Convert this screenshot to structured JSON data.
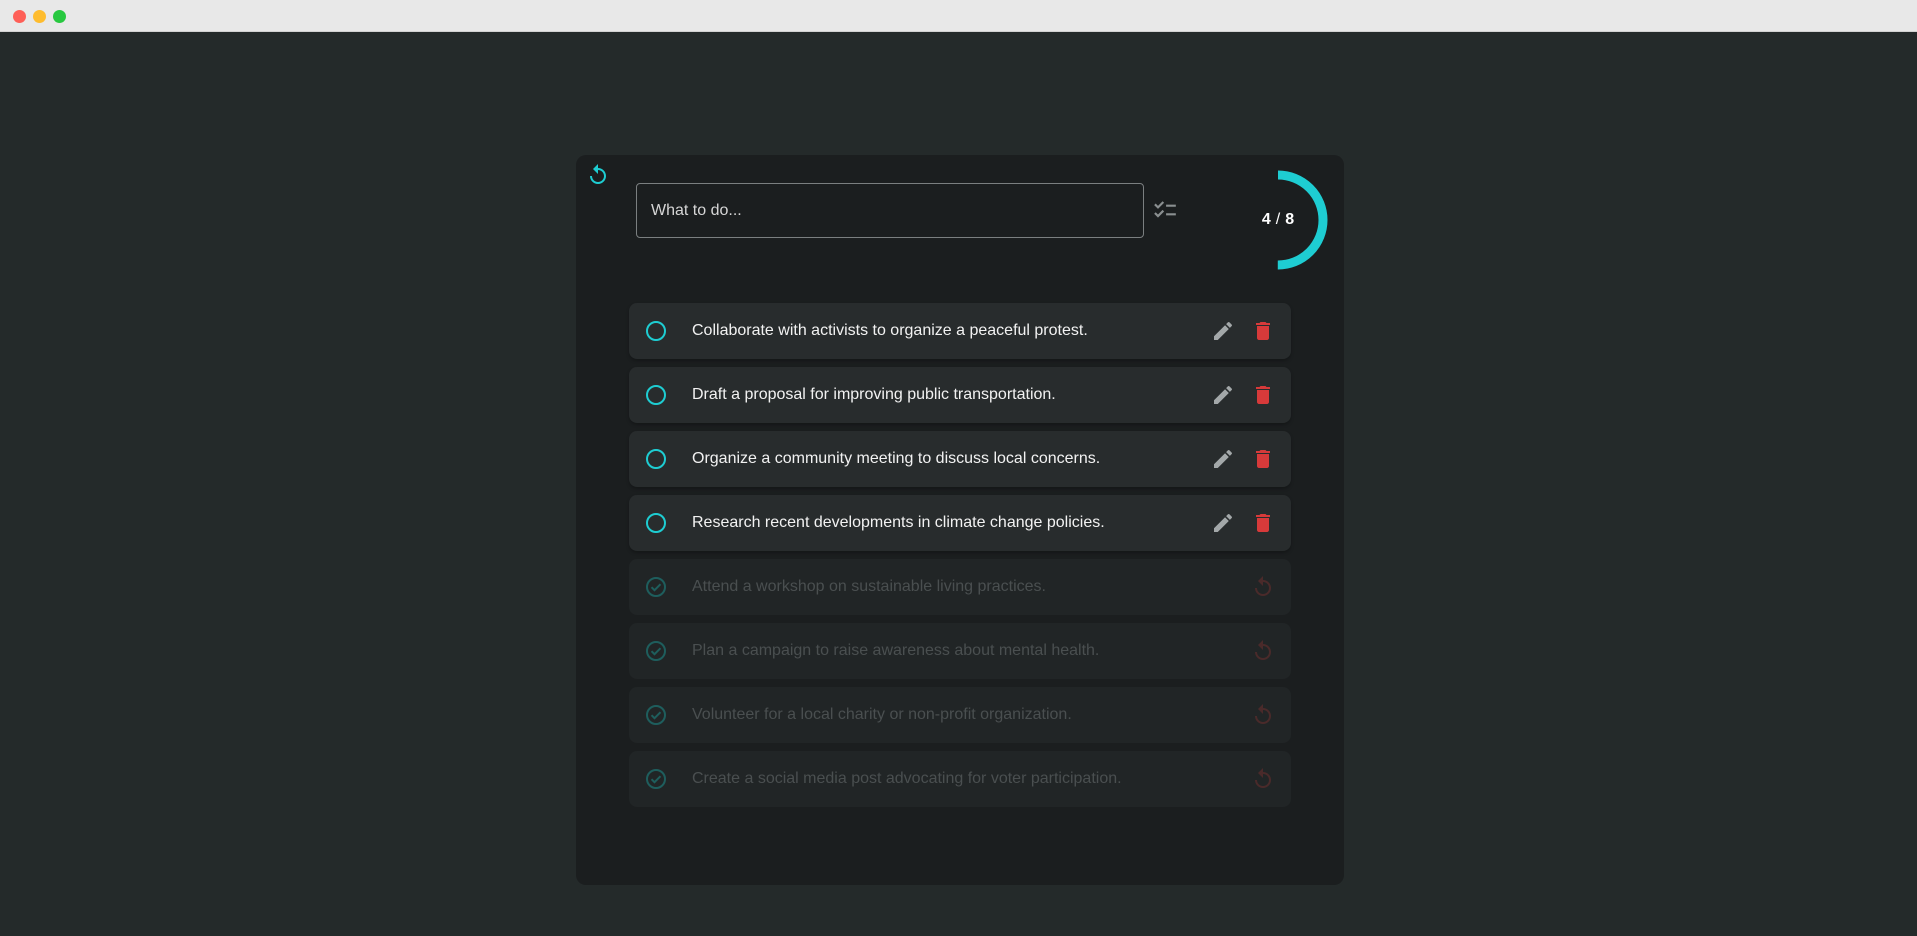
{
  "colors": {
    "accent": "#1ecdd2",
    "danger": "#d73a3a",
    "icon_muted": "#9aa0a1",
    "done_icon": "#1e5e5d",
    "done_undo": "#4a2a2a"
  },
  "header": {
    "reset_icon": "refresh-icon",
    "input_placeholder": "What to do...",
    "input_value": "",
    "add_icon": "checklist-icon"
  },
  "progress": {
    "completed": "4",
    "separator": "/",
    "total": "8",
    "fraction": 0.5
  },
  "tasks": {
    "active": [
      {
        "text": "Collaborate with activists to organize a peaceful protest."
      },
      {
        "text": "Draft a proposal for improving public transportation."
      },
      {
        "text": "Organize a community meeting to discuss local concerns."
      },
      {
        "text": "Research recent developments in climate change policies."
      }
    ],
    "completed": [
      {
        "text": "Attend a workshop on sustainable living practices."
      },
      {
        "text": "Plan a campaign to raise awareness about mental health."
      },
      {
        "text": "Volunteer for a local charity or non-profit organization."
      },
      {
        "text": "Create a social media post advocating for voter participation."
      }
    ]
  },
  "icons": {
    "active_check": "circle-icon",
    "done_check": "check-circle-icon",
    "edit": "pencil-icon",
    "delete": "trash-icon",
    "undo": "undo-icon"
  }
}
